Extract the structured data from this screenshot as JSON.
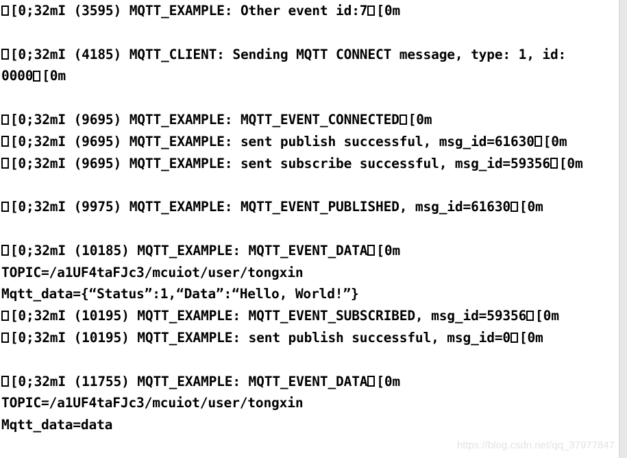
{
  "console": {
    "background_color": "#ffffff",
    "text_color": "#000000",
    "escape_glyph_name": "missing-glyph-box",
    "lines": [
      {
        "id": "line-1",
        "type": "log",
        "esc_prefix": true,
        "text": "[0;32mI (3595) MQTT_EXAMPLE: Other event id:7",
        "esc_suffix": true,
        "suffix_text": "[0m"
      },
      {
        "id": "line-2",
        "type": "blank",
        "text": ""
      },
      {
        "id": "line-3",
        "type": "log",
        "esc_prefix": true,
        "text": "[0;32mI (4185) MQTT_CLIENT: Sending MQTT CONNECT message, type: 1, id:",
        "esc_suffix": false,
        "suffix_text": ""
      },
      {
        "id": "line-4",
        "type": "cont",
        "esc_prefix": false,
        "text": "0000",
        "esc_suffix": true,
        "suffix_text": "[0m"
      },
      {
        "id": "line-5",
        "type": "blank",
        "text": ""
      },
      {
        "id": "line-6",
        "type": "log",
        "esc_prefix": true,
        "text": "[0;32mI (9695) MQTT_EXAMPLE: MQTT_EVENT_CONNECTED",
        "esc_suffix": true,
        "suffix_text": "[0m"
      },
      {
        "id": "line-7",
        "type": "log",
        "esc_prefix": true,
        "text": "[0;32mI (9695) MQTT_EXAMPLE: sent publish successful, msg_id=61630",
        "esc_suffix": true,
        "suffix_text": "[0m"
      },
      {
        "id": "line-8",
        "type": "log",
        "esc_prefix": true,
        "text": "[0;32mI (9695) MQTT_EXAMPLE: sent subscribe successful, msg_id=59356",
        "esc_suffix": true,
        "suffix_text": "[0m"
      },
      {
        "id": "line-9",
        "type": "blank",
        "text": ""
      },
      {
        "id": "line-10",
        "type": "log",
        "esc_prefix": true,
        "text": "[0;32mI (9975) MQTT_EXAMPLE: MQTT_EVENT_PUBLISHED, msg_id=61630",
        "esc_suffix": true,
        "suffix_text": "[0m"
      },
      {
        "id": "line-11",
        "type": "blank",
        "text": ""
      },
      {
        "id": "line-12",
        "type": "log",
        "esc_prefix": true,
        "text": "[0;32mI (10185) MQTT_EXAMPLE: MQTT_EVENT_DATA",
        "esc_suffix": true,
        "suffix_text": "[0m"
      },
      {
        "id": "line-13",
        "type": "cont",
        "esc_prefix": false,
        "text": "TOPIC=/a1UF4taFJc3/mcuiot/user/tongxin",
        "esc_suffix": false,
        "suffix_text": ""
      },
      {
        "id": "line-14",
        "type": "cont",
        "esc_prefix": false,
        "text": "Mqtt_data={“Status”:1,“Data”:“Hello, World!”}",
        "esc_suffix": false,
        "suffix_text": ""
      },
      {
        "id": "line-15",
        "type": "log",
        "esc_prefix": true,
        "text": "[0;32mI (10195) MQTT_EXAMPLE: MQTT_EVENT_SUBSCRIBED, msg_id=59356",
        "esc_suffix": true,
        "suffix_text": "[0m"
      },
      {
        "id": "line-16",
        "type": "log",
        "esc_prefix": true,
        "text": "[0;32mI (10195) MQTT_EXAMPLE: sent publish successful, msg_id=0",
        "esc_suffix": true,
        "suffix_text": "[0m"
      },
      {
        "id": "line-17",
        "type": "blank",
        "text": ""
      },
      {
        "id": "line-18",
        "type": "log",
        "esc_prefix": true,
        "text": "[0;32mI (11755) MQTT_EXAMPLE: MQTT_EVENT_DATA",
        "esc_suffix": true,
        "suffix_text": "[0m"
      },
      {
        "id": "line-19",
        "type": "cont",
        "esc_prefix": false,
        "text": "TOPIC=/a1UF4taFJc3/mcuiot/user/tongxin",
        "esc_suffix": false,
        "suffix_text": ""
      },
      {
        "id": "line-20",
        "type": "cont",
        "esc_prefix": false,
        "text": "Mqtt_data=data",
        "esc_suffix": false,
        "suffix_text": ""
      }
    ]
  },
  "watermark": {
    "text": "https://blog.csdn.net/qq_37977847",
    "color": "#e3e3e3"
  },
  "scrollbar": {
    "track_color": "#e7e7e7"
  }
}
